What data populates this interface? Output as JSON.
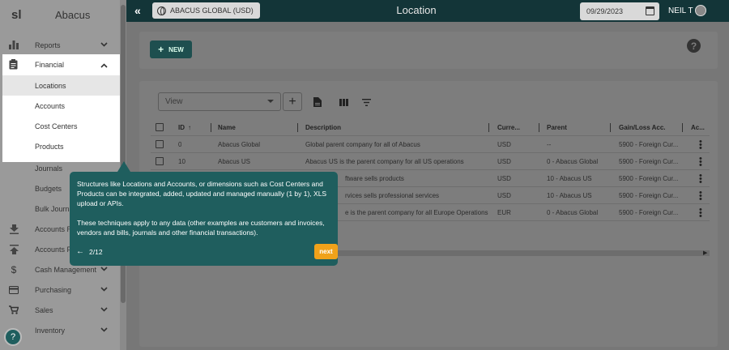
{
  "app": {
    "logo": "sl",
    "name": "Abacus"
  },
  "sidebar": {
    "items": [
      {
        "label": "Reports",
        "icon": "bar-chart-icon",
        "chevron": "⌄"
      },
      {
        "label": "Financial",
        "icon": "clipboard-icon",
        "chevron": "⌃"
      },
      {
        "label": "Journals"
      },
      {
        "label": "Budgets"
      },
      {
        "label": "Bulk Journa"
      },
      {
        "label": "Accounts Re",
        "icon": "download-icon"
      },
      {
        "label": "Accounts Pa",
        "icon": "upload-icon"
      },
      {
        "label": "Cash Management",
        "icon": "dollar-icon",
        "chevron": "⌄"
      },
      {
        "label": "Purchasing",
        "icon": "credit-card-icon",
        "chevron": "⌄"
      },
      {
        "label": "Sales",
        "icon": "cart-icon",
        "chevron": "⌄"
      },
      {
        "label": "Inventory",
        "icon": "box-icon",
        "chevron": "⌄"
      }
    ],
    "financial_sub": [
      "Locations",
      "Accounts",
      "Cost Centers",
      "Products"
    ],
    "help": "?"
  },
  "topbar": {
    "collapse": "«",
    "org": "ABACUS GLOBAL (USD)",
    "title": "Location",
    "date": "09/29/2023",
    "user": "NEIL T"
  },
  "toolbar": {
    "new_label": "NEW",
    "new_icon": "+",
    "help": "?"
  },
  "view": {
    "placeholder": "View",
    "add": "+"
  },
  "table": {
    "columns": [
      "ID",
      "Name",
      "Description",
      "Curre...",
      "Parent",
      "Gain/Loss Acc.",
      "Ac..."
    ],
    "sort_indicator": "↑",
    "rows": [
      [
        "0",
        "Abacus Global",
        "Global parent company for all of Abacus",
        "USD",
        "--",
        "5900 - Foreign Cur..."
      ],
      [
        "10",
        "Abacus US",
        "Abacus US is the parent company for all US operations",
        "USD",
        "0 - Abacus Global",
        "5900 - Foreign Cur..."
      ],
      [
        "",
        "",
        "ftware sells products",
        "USD",
        "10 - Abacus US",
        "5900 - Foreign Cur..."
      ],
      [
        "",
        "",
        "rvices sells professional services",
        "USD",
        "10 - Abacus US",
        "5900 - Foreign Cur..."
      ],
      [
        "",
        "",
        "e is the parent company for all Europe Operations",
        "EUR",
        "0 - Abacus Global",
        "5900 - Foreign Cur..."
      ]
    ]
  },
  "tour": {
    "paragraph1": "Structures like Locations and Accounts, or dimensions such as Cost Centers and Products can be integrated, added, updated and managed manually (1 by 1), XLS upload or APIs.",
    "paragraph2": "These techniques apply to any data (other examples are customers and invoices, vendors and bills, journals and other financial transactions).",
    "prev": "←",
    "step": "2/12",
    "next": "next"
  }
}
